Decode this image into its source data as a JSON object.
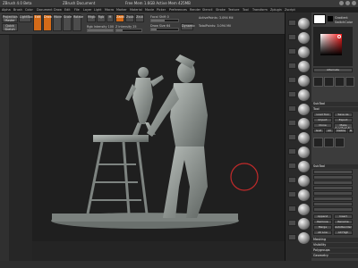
{
  "app": {
    "title": "ZBrush 4.0 Beta",
    "doc_title": "ZBrush Document",
    "info": "Free Mem 1.6GB  Active Mem 425MB"
  },
  "menu": [
    "Alpha",
    "Brush",
    "Color",
    "Document",
    "Draw",
    "Edit",
    "File",
    "Layer",
    "Light",
    "Macro",
    "Marker",
    "Material",
    "Movie",
    "Picker",
    "Preferences",
    "Render",
    "Stencil",
    "Stroke",
    "Texture",
    "Tool",
    "Transform",
    "Zplugin",
    "Zscript"
  ],
  "toolbar": {
    "projection_master": "Projection Master",
    "lightbox": "LightBox",
    "quick_sketch": "Quick Sketch",
    "edit": "Edit",
    "draw": "Draw",
    "move": "Move",
    "scale": "Scale",
    "rotate": "Rotate",
    "mrgb": "Mrgb",
    "rgb": "Rgb",
    "m": "M",
    "zadd": "Zadd",
    "zsub": "Zsub",
    "zcut": "Zcut",
    "focal_shift": "Focal Shift 0",
    "draw_size": "Draw Size 64",
    "dynamic": "Dynamic",
    "rgb_intensity": "Rgb Intensity 100",
    "z_intensity": "Z Intensity 25",
    "active_points": "ActivePoints: 3.094 Mil",
    "total_points": "TotalPoints: 3.094 Mil"
  },
  "right_panel": {
    "gradient": "Gradient",
    "switch_color": "SwitchColor",
    "alternate": "Alternate",
    "subtool": "SubTool",
    "tool": "Tool",
    "load_tool": "Load Tool",
    "save_as": "Save As",
    "import": "Import",
    "export": "Export",
    "clone": "Clone",
    "make_polymesh": "Make PolyMesh3D",
    "goz": "GoZ",
    "all": "All",
    "visible": "Visible",
    "r": "R",
    "merge": "Merge",
    "append": "Append",
    "insert": "Insert",
    "remove": "Remove",
    "rename": "Rename",
    "auto_reorder": "AutoReorder",
    "all_low": "All Low",
    "all_high": "All High",
    "masking": "Masking",
    "visibility": "Visibility",
    "polygroups": "Polygroups",
    "geometry": "Geometry",
    "layers": "Layers",
    "fibermesh": "FiberMesh",
    "morph_target": "Morph Target"
  },
  "colors": {
    "accent": "#d36a18",
    "ui_bg": "#3b3b3b",
    "canvas_bg": "#1f1f1f",
    "cursor_ring": "#c22a2a",
    "model": "#8a908c"
  }
}
